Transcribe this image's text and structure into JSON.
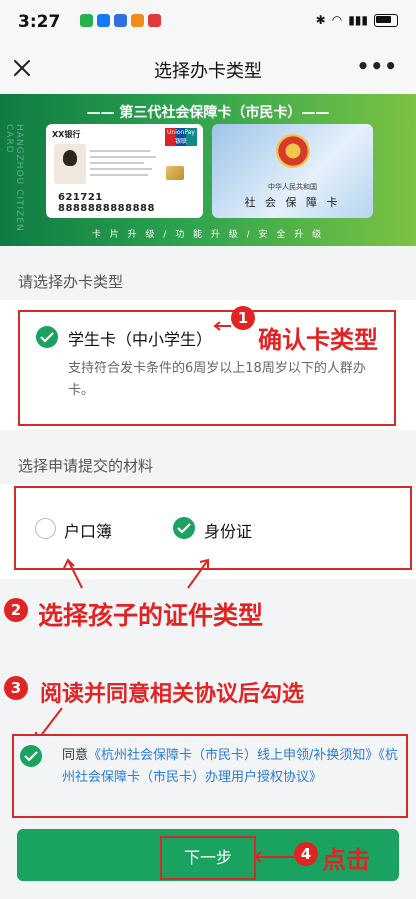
{
  "status_bar": {
    "time": "3:27"
  },
  "nav": {
    "title": "选择办卡类型",
    "more": "•••"
  },
  "banner": {
    "title": "—— 第三代社会保障卡（市民卡）——",
    "side_text": "HANGZHOU CITIZEN CARD",
    "card_front": {
      "bank": "XX银行",
      "union_pay": "UnionPay 银联",
      "number": "621721 8888888888888"
    },
    "card_back": {
      "country": "中华人民共和国",
      "name": "社 会 保 障 卡"
    },
    "slogan": "卡 片 升 级 / 功 能 升 级 / 安 全 升 级"
  },
  "card_type": {
    "section_label": "请选择办卡类型",
    "option_title": "学生卡（中小学生）",
    "option_desc": "支持符合发卡条件的6周岁以上18周岁以下的人群办卡。"
  },
  "materials": {
    "section_label": "选择申请提交的材料",
    "option1": "户口簿",
    "option2": "身份证"
  },
  "agreement": {
    "prefix": "同意",
    "link1": "《杭州社会保障卡（市民卡）线上申领/补换须知》",
    "link2": "《杭州社会保障卡（市民卡）办理用户授权协议》"
  },
  "next_button": {
    "label": "下一步"
  },
  "annotations": {
    "n1": "1",
    "a1": "确认卡类型",
    "n2": "2",
    "a2": "选择孩子的证件类型",
    "n3": "3",
    "a3": "阅读并同意相关协议后勾选",
    "n4": "4",
    "a4": "点击"
  },
  "colors": {
    "accent_green": "#1aa260",
    "annotation_red": "#e02424",
    "link_blue": "#2a7bd5"
  }
}
